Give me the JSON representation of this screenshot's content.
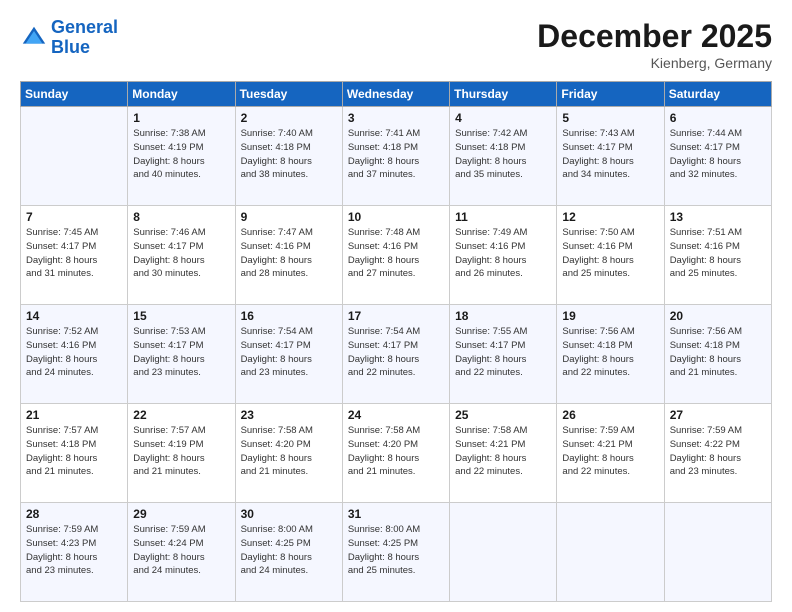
{
  "header": {
    "logo_line1": "General",
    "logo_line2": "Blue",
    "month_title": "December 2025",
    "subtitle": "Kienberg, Germany"
  },
  "days_of_week": [
    "Sunday",
    "Monday",
    "Tuesday",
    "Wednesday",
    "Thursday",
    "Friday",
    "Saturday"
  ],
  "weeks": [
    [
      {
        "day": "",
        "info": ""
      },
      {
        "day": "1",
        "info": "Sunrise: 7:38 AM\nSunset: 4:19 PM\nDaylight: 8 hours\nand 40 minutes."
      },
      {
        "day": "2",
        "info": "Sunrise: 7:40 AM\nSunset: 4:18 PM\nDaylight: 8 hours\nand 38 minutes."
      },
      {
        "day": "3",
        "info": "Sunrise: 7:41 AM\nSunset: 4:18 PM\nDaylight: 8 hours\nand 37 minutes."
      },
      {
        "day": "4",
        "info": "Sunrise: 7:42 AM\nSunset: 4:18 PM\nDaylight: 8 hours\nand 35 minutes."
      },
      {
        "day": "5",
        "info": "Sunrise: 7:43 AM\nSunset: 4:17 PM\nDaylight: 8 hours\nand 34 minutes."
      },
      {
        "day": "6",
        "info": "Sunrise: 7:44 AM\nSunset: 4:17 PM\nDaylight: 8 hours\nand 32 minutes."
      }
    ],
    [
      {
        "day": "7",
        "info": "Sunrise: 7:45 AM\nSunset: 4:17 PM\nDaylight: 8 hours\nand 31 minutes."
      },
      {
        "day": "8",
        "info": "Sunrise: 7:46 AM\nSunset: 4:17 PM\nDaylight: 8 hours\nand 30 minutes."
      },
      {
        "day": "9",
        "info": "Sunrise: 7:47 AM\nSunset: 4:16 PM\nDaylight: 8 hours\nand 28 minutes."
      },
      {
        "day": "10",
        "info": "Sunrise: 7:48 AM\nSunset: 4:16 PM\nDaylight: 8 hours\nand 27 minutes."
      },
      {
        "day": "11",
        "info": "Sunrise: 7:49 AM\nSunset: 4:16 PM\nDaylight: 8 hours\nand 26 minutes."
      },
      {
        "day": "12",
        "info": "Sunrise: 7:50 AM\nSunset: 4:16 PM\nDaylight: 8 hours\nand 25 minutes."
      },
      {
        "day": "13",
        "info": "Sunrise: 7:51 AM\nSunset: 4:16 PM\nDaylight: 8 hours\nand 25 minutes."
      }
    ],
    [
      {
        "day": "14",
        "info": "Sunrise: 7:52 AM\nSunset: 4:16 PM\nDaylight: 8 hours\nand 24 minutes."
      },
      {
        "day": "15",
        "info": "Sunrise: 7:53 AM\nSunset: 4:17 PM\nDaylight: 8 hours\nand 23 minutes."
      },
      {
        "day": "16",
        "info": "Sunrise: 7:54 AM\nSunset: 4:17 PM\nDaylight: 8 hours\nand 23 minutes."
      },
      {
        "day": "17",
        "info": "Sunrise: 7:54 AM\nSunset: 4:17 PM\nDaylight: 8 hours\nand 22 minutes."
      },
      {
        "day": "18",
        "info": "Sunrise: 7:55 AM\nSunset: 4:17 PM\nDaylight: 8 hours\nand 22 minutes."
      },
      {
        "day": "19",
        "info": "Sunrise: 7:56 AM\nSunset: 4:18 PM\nDaylight: 8 hours\nand 22 minutes."
      },
      {
        "day": "20",
        "info": "Sunrise: 7:56 AM\nSunset: 4:18 PM\nDaylight: 8 hours\nand 21 minutes."
      }
    ],
    [
      {
        "day": "21",
        "info": "Sunrise: 7:57 AM\nSunset: 4:18 PM\nDaylight: 8 hours\nand 21 minutes."
      },
      {
        "day": "22",
        "info": "Sunrise: 7:57 AM\nSunset: 4:19 PM\nDaylight: 8 hours\nand 21 minutes."
      },
      {
        "day": "23",
        "info": "Sunrise: 7:58 AM\nSunset: 4:20 PM\nDaylight: 8 hours\nand 21 minutes."
      },
      {
        "day": "24",
        "info": "Sunrise: 7:58 AM\nSunset: 4:20 PM\nDaylight: 8 hours\nand 21 minutes."
      },
      {
        "day": "25",
        "info": "Sunrise: 7:58 AM\nSunset: 4:21 PM\nDaylight: 8 hours\nand 22 minutes."
      },
      {
        "day": "26",
        "info": "Sunrise: 7:59 AM\nSunset: 4:21 PM\nDaylight: 8 hours\nand 22 minutes."
      },
      {
        "day": "27",
        "info": "Sunrise: 7:59 AM\nSunset: 4:22 PM\nDaylight: 8 hours\nand 23 minutes."
      }
    ],
    [
      {
        "day": "28",
        "info": "Sunrise: 7:59 AM\nSunset: 4:23 PM\nDaylight: 8 hours\nand 23 minutes."
      },
      {
        "day": "29",
        "info": "Sunrise: 7:59 AM\nSunset: 4:24 PM\nDaylight: 8 hours\nand 24 minutes."
      },
      {
        "day": "30",
        "info": "Sunrise: 8:00 AM\nSunset: 4:25 PM\nDaylight: 8 hours\nand 24 minutes."
      },
      {
        "day": "31",
        "info": "Sunrise: 8:00 AM\nSunset: 4:25 PM\nDaylight: 8 hours\nand 25 minutes."
      },
      {
        "day": "",
        "info": ""
      },
      {
        "day": "",
        "info": ""
      },
      {
        "day": "",
        "info": ""
      }
    ]
  ]
}
